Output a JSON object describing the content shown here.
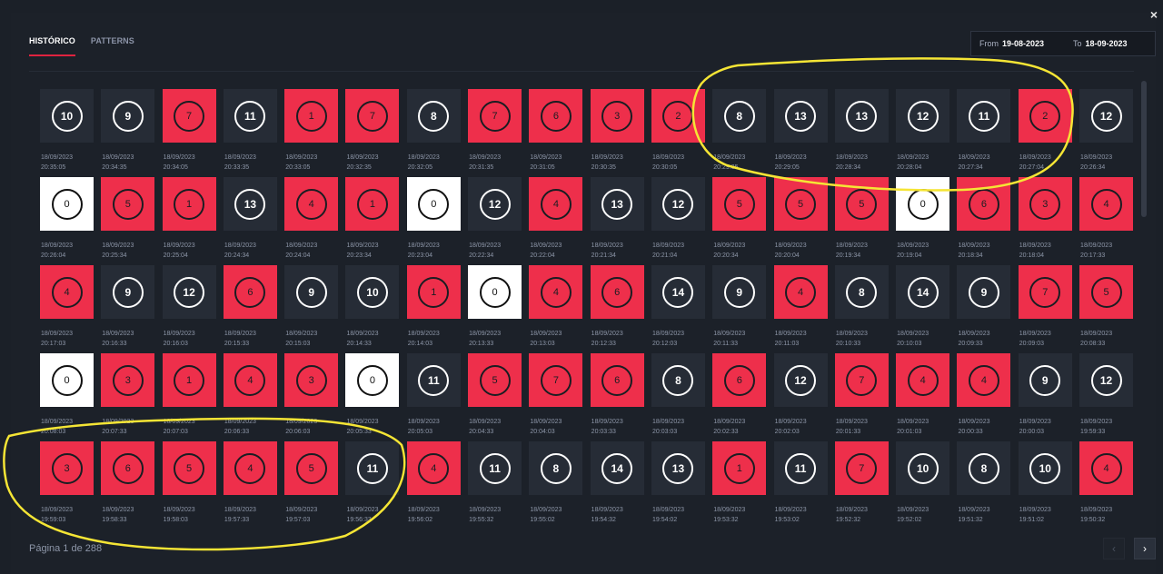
{
  "tabs": [
    {
      "label": "HISTÓRICO",
      "active": true
    },
    {
      "label": "PATTERNS",
      "active": false
    }
  ],
  "date_range": {
    "from_label": "From",
    "from_value": "19-08-2023",
    "to_label": "To",
    "to_value": "18-09-2023"
  },
  "close_label": "×",
  "colors": {
    "red": "#ee2f4b",
    "dark": "#262c36",
    "white": "#ffffff",
    "annotation": "#f5e535"
  },
  "results": [
    {
      "number": "10",
      "color": "dark",
      "date": "18/09/2023",
      "time": "20:35:05"
    },
    {
      "number": "9",
      "color": "dark",
      "date": "18/09/2023",
      "time": "20:34:35"
    },
    {
      "number": "7",
      "color": "red",
      "date": "18/09/2023",
      "time": "20:34:05"
    },
    {
      "number": "11",
      "color": "dark",
      "date": "18/09/2023",
      "time": "20:33:35"
    },
    {
      "number": "1",
      "color": "red",
      "date": "18/09/2023",
      "time": "20:33:05"
    },
    {
      "number": "7",
      "color": "red",
      "date": "18/09/2023",
      "time": "20:32:35"
    },
    {
      "number": "8",
      "color": "dark",
      "date": "18/09/2023",
      "time": "20:32:05"
    },
    {
      "number": "7",
      "color": "red",
      "date": "18/09/2023",
      "time": "20:31:35"
    },
    {
      "number": "6",
      "color": "red",
      "date": "18/09/2023",
      "time": "20:31:05"
    },
    {
      "number": "3",
      "color": "red",
      "date": "18/09/2023",
      "time": "20:30:35"
    },
    {
      "number": "2",
      "color": "red",
      "date": "18/09/2023",
      "time": "20:30:05"
    },
    {
      "number": "8",
      "color": "dark",
      "date": "18/09/2023",
      "time": "20:29:35"
    },
    {
      "number": "13",
      "color": "dark",
      "date": "18/09/2023",
      "time": "20:29:05"
    },
    {
      "number": "13",
      "color": "dark",
      "date": "18/09/2023",
      "time": "20:28:34"
    },
    {
      "number": "12",
      "color": "dark",
      "date": "18/09/2023",
      "time": "20:28:04"
    },
    {
      "number": "11",
      "color": "dark",
      "date": "18/09/2023",
      "time": "20:27:34"
    },
    {
      "number": "2",
      "color": "red",
      "date": "18/09/2023",
      "time": "20:27:04"
    },
    {
      "number": "12",
      "color": "dark",
      "date": "18/09/2023",
      "time": "20:26:34"
    },
    {
      "number": "0",
      "color": "white",
      "date": "18/09/2023",
      "time": "20:26:04"
    },
    {
      "number": "5",
      "color": "red",
      "date": "18/09/2023",
      "time": "20:25:34"
    },
    {
      "number": "1",
      "color": "red",
      "date": "18/09/2023",
      "time": "20:25:04"
    },
    {
      "number": "13",
      "color": "dark",
      "date": "18/09/2023",
      "time": "20:24:34"
    },
    {
      "number": "4",
      "color": "red",
      "date": "18/09/2023",
      "time": "20:24:04"
    },
    {
      "number": "1",
      "color": "red",
      "date": "18/09/2023",
      "time": "20:23:34"
    },
    {
      "number": "0",
      "color": "white",
      "date": "18/09/2023",
      "time": "20:23:04"
    },
    {
      "number": "12",
      "color": "dark",
      "date": "18/09/2023",
      "time": "20:22:34"
    },
    {
      "number": "4",
      "color": "red",
      "date": "18/09/2023",
      "time": "20:22:04"
    },
    {
      "number": "13",
      "color": "dark",
      "date": "18/09/2023",
      "time": "20:21:34"
    },
    {
      "number": "12",
      "color": "dark",
      "date": "18/09/2023",
      "time": "20:21:04"
    },
    {
      "number": "5",
      "color": "red",
      "date": "18/09/2023",
      "time": "20:20:34"
    },
    {
      "number": "5",
      "color": "red",
      "date": "18/09/2023",
      "time": "20:20:04"
    },
    {
      "number": "5",
      "color": "red",
      "date": "18/09/2023",
      "time": "20:19:34"
    },
    {
      "number": "0",
      "color": "white",
      "date": "18/09/2023",
      "time": "20:19:04"
    },
    {
      "number": "6",
      "color": "red",
      "date": "18/09/2023",
      "time": "20:18:34"
    },
    {
      "number": "3",
      "color": "red",
      "date": "18/09/2023",
      "time": "20:18:04"
    },
    {
      "number": "4",
      "color": "red",
      "date": "18/09/2023",
      "time": "20:17:33"
    },
    {
      "number": "4",
      "color": "red",
      "date": "18/09/2023",
      "time": "20:17:03"
    },
    {
      "number": "9",
      "color": "dark",
      "date": "18/09/2023",
      "time": "20:16:33"
    },
    {
      "number": "12",
      "color": "dark",
      "date": "18/09/2023",
      "time": "20:16:03"
    },
    {
      "number": "6",
      "color": "red",
      "date": "18/09/2023",
      "time": "20:15:33"
    },
    {
      "number": "9",
      "color": "dark",
      "date": "18/09/2023",
      "time": "20:15:03"
    },
    {
      "number": "10",
      "color": "dark",
      "date": "18/09/2023",
      "time": "20:14:33"
    },
    {
      "number": "1",
      "color": "red",
      "date": "18/09/2023",
      "time": "20:14:03"
    },
    {
      "number": "0",
      "color": "white",
      "date": "18/09/2023",
      "time": "20:13:33"
    },
    {
      "number": "4",
      "color": "red",
      "date": "18/09/2023",
      "time": "20:13:03"
    },
    {
      "number": "6",
      "color": "red",
      "date": "18/09/2023",
      "time": "20:12:33"
    },
    {
      "number": "14",
      "color": "dark",
      "date": "18/09/2023",
      "time": "20:12:03"
    },
    {
      "number": "9",
      "color": "dark",
      "date": "18/09/2023",
      "time": "20:11:33"
    },
    {
      "number": "4",
      "color": "red",
      "date": "18/09/2023",
      "time": "20:11:03"
    },
    {
      "number": "8",
      "color": "dark",
      "date": "18/09/2023",
      "time": "20:10:33"
    },
    {
      "number": "14",
      "color": "dark",
      "date": "18/09/2023",
      "time": "20:10:03"
    },
    {
      "number": "9",
      "color": "dark",
      "date": "18/09/2023",
      "time": "20:09:33"
    },
    {
      "number": "7",
      "color": "red",
      "date": "18/09/2023",
      "time": "20:09:03"
    },
    {
      "number": "5",
      "color": "red",
      "date": "18/09/2023",
      "time": "20:08:33"
    },
    {
      "number": "0",
      "color": "white",
      "date": "18/09/2023",
      "time": "20:08:03"
    },
    {
      "number": "3",
      "color": "red",
      "date": "18/09/2023",
      "time": "20:07:33"
    },
    {
      "number": "1",
      "color": "red",
      "date": "18/09/2023",
      "time": "20:07:03"
    },
    {
      "number": "4",
      "color": "red",
      "date": "18/09/2023",
      "time": "20:06:33"
    },
    {
      "number": "3",
      "color": "red",
      "date": "18/09/2023",
      "time": "20:06:03"
    },
    {
      "number": "0",
      "color": "white",
      "date": "18/09/2023",
      "time": "20:05:33"
    },
    {
      "number": "11",
      "color": "dark",
      "date": "18/09/2023",
      "time": "20:05:03"
    },
    {
      "number": "5",
      "color": "red",
      "date": "18/09/2023",
      "time": "20:04:33"
    },
    {
      "number": "7",
      "color": "red",
      "date": "18/09/2023",
      "time": "20:04:03"
    },
    {
      "number": "6",
      "color": "red",
      "date": "18/09/2023",
      "time": "20:03:33"
    },
    {
      "number": "8",
      "color": "dark",
      "date": "18/09/2023",
      "time": "20:03:03"
    },
    {
      "number": "6",
      "color": "red",
      "date": "18/09/2023",
      "time": "20:02:33"
    },
    {
      "number": "12",
      "color": "dark",
      "date": "18/09/2023",
      "time": "20:02:03"
    },
    {
      "number": "7",
      "color": "red",
      "date": "18/09/2023",
      "time": "20:01:33"
    },
    {
      "number": "4",
      "color": "red",
      "date": "18/09/2023",
      "time": "20:01:03"
    },
    {
      "number": "4",
      "color": "red",
      "date": "18/09/2023",
      "time": "20:00:33"
    },
    {
      "number": "9",
      "color": "dark",
      "date": "18/09/2023",
      "time": "20:00:03"
    },
    {
      "number": "12",
      "color": "dark",
      "date": "18/09/2023",
      "time": "19:59:33"
    },
    {
      "number": "3",
      "color": "red",
      "date": "18/09/2023",
      "time": "19:59:03"
    },
    {
      "number": "6",
      "color": "red",
      "date": "18/09/2023",
      "time": "19:58:33"
    },
    {
      "number": "5",
      "color": "red",
      "date": "18/09/2023",
      "time": "19:58:03"
    },
    {
      "number": "4",
      "color": "red",
      "date": "18/09/2023",
      "time": "19:57:33"
    },
    {
      "number": "5",
      "color": "red",
      "date": "18/09/2023",
      "time": "19:57:03"
    },
    {
      "number": "11",
      "color": "dark",
      "date": "18/09/2023",
      "time": "19:56:33"
    },
    {
      "number": "4",
      "color": "red",
      "date": "18/09/2023",
      "time": "19:56:02"
    },
    {
      "number": "11",
      "color": "dark",
      "date": "18/09/2023",
      "time": "19:55:32"
    },
    {
      "number": "8",
      "color": "dark",
      "date": "18/09/2023",
      "time": "19:55:02"
    },
    {
      "number": "14",
      "color": "dark",
      "date": "18/09/2023",
      "time": "19:54:32"
    },
    {
      "number": "13",
      "color": "dark",
      "date": "18/09/2023",
      "time": "19:54:02"
    },
    {
      "number": "1",
      "color": "red",
      "date": "18/09/2023",
      "time": "19:53:32"
    },
    {
      "number": "11",
      "color": "dark",
      "date": "18/09/2023",
      "time": "19:53:02"
    },
    {
      "number": "7",
      "color": "red",
      "date": "18/09/2023",
      "time": "19:52:32"
    },
    {
      "number": "10",
      "color": "dark",
      "date": "18/09/2023",
      "time": "19:52:02"
    },
    {
      "number": "8",
      "color": "dark",
      "date": "18/09/2023",
      "time": "19:51:32"
    },
    {
      "number": "10",
      "color": "dark",
      "date": "18/09/2023",
      "time": "19:51:02"
    },
    {
      "number": "4",
      "color": "red",
      "date": "18/09/2023",
      "time": "19:50:32"
    }
  ],
  "pagination": {
    "label": "Página 1 de 288",
    "prev_icon": "chevron-left-icon",
    "next_icon": "chevron-right-icon"
  }
}
